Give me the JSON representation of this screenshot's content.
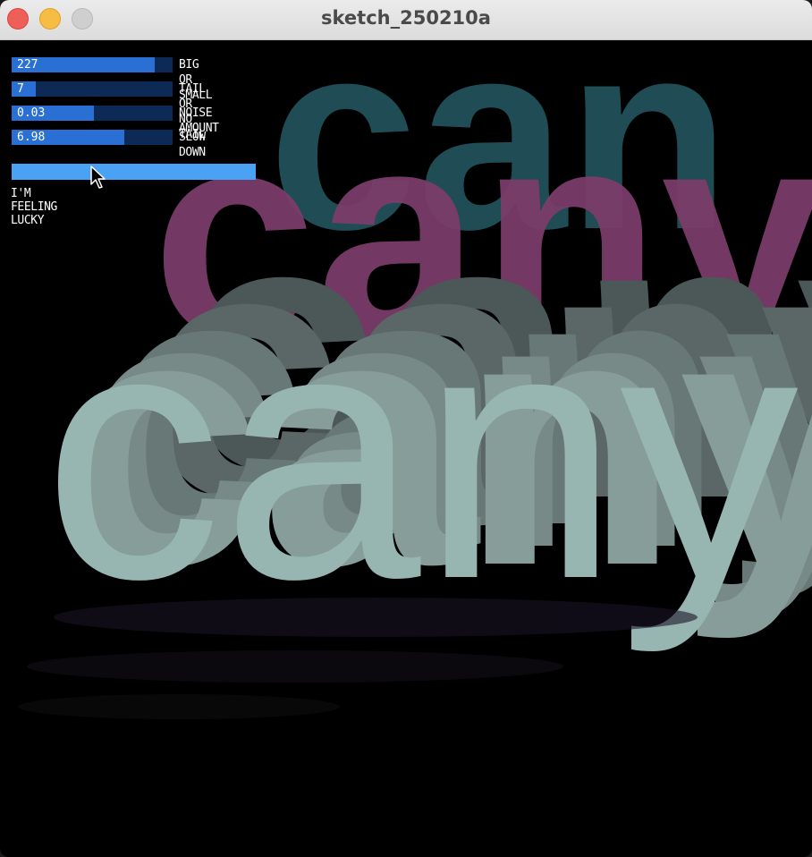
{
  "window": {
    "title": "sketch_250210a"
  },
  "sliders": [
    {
      "value_label": "227",
      "label": "BIG OR SMALL",
      "fill": 0.89
    },
    {
      "value_label": "7",
      "label": "TAIL OR NO TAIL",
      "fill": 0.15
    },
    {
      "value_label": "0.03",
      "label": "NOISE AMOUNT",
      "fill": 0.51
    },
    {
      "value_label": "6.98",
      "label": "SLOW DOWN",
      "fill": 0.7
    }
  ],
  "lucky_button": {
    "label": "I'M FEELING LUCKY"
  },
  "artwork": {
    "main_text": "cany",
    "back_text": "can",
    "mid_text": "cany"
  },
  "colors": {
    "slider_track": "#0c2a55",
    "slider_fill": "#2a6fd4",
    "button": "#4aa2f5",
    "text_front": "#97b5b1",
    "text_mid": "#7a3d6a",
    "text_back": "#1f4c55"
  }
}
